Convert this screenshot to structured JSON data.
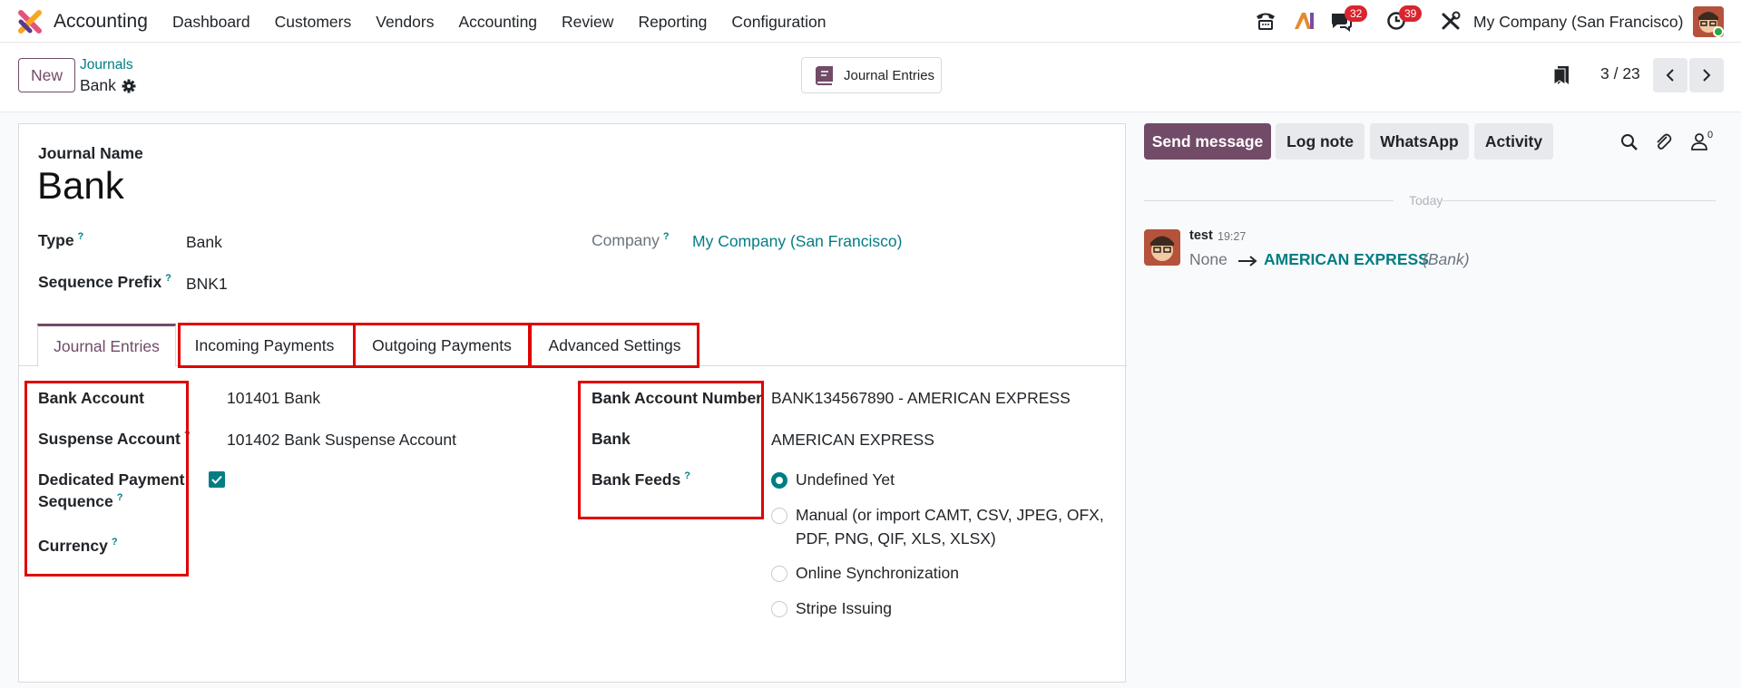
{
  "topbar": {
    "app_name": "Accounting",
    "menu": [
      "Dashboard",
      "Customers",
      "Vendors",
      "Accounting",
      "Review",
      "Reporting",
      "Configuration"
    ],
    "messages_count": "32",
    "activities_count": "39",
    "company": "My Company (San Francisco)"
  },
  "control_panel": {
    "new_label": "New",
    "breadcrumb_parent": "Journals",
    "breadcrumb_current": "Bank",
    "journal_entries_button": "Journal Entries",
    "pager": "3 / 23"
  },
  "form": {
    "journal_name_label": "Journal Name",
    "journal_name": "Bank",
    "type_label": "Type",
    "type_value": "Bank",
    "company_label": "Company",
    "company_value": "My Company (San Francisco)",
    "sequence_prefix_label": "Sequence Prefix",
    "sequence_prefix_value": "BNK1",
    "tabs": [
      "Journal Entries",
      "Incoming Payments",
      "Outgoing Payments",
      "Advanced Settings"
    ],
    "bank_account_label": "Bank Account",
    "bank_account_value": "101401 Bank",
    "suspense_account_label": "Suspense Account",
    "suspense_account_value": "101402 Bank Suspense Account",
    "dedicated_payment_label_1": "Dedicated Payment",
    "dedicated_payment_label_2": "Sequence",
    "dedicated_payment_checked": true,
    "currency_label": "Currency",
    "bank_account_number_label": "Bank Account Number",
    "bank_account_number_value": "BANK134567890 - AMERICAN EXPRESS",
    "bank_label": "Bank",
    "bank_value": "AMERICAN EXPRESS",
    "bank_feeds_label": "Bank Feeds",
    "bank_feeds_options": [
      "Undefined Yet",
      "Manual (or import CAMT, CSV, JPEG, OFX,",
      "PDF, PNG, QIF, XLS, XLSX)",
      "Online Synchronization",
      "Stripe Issuing"
    ],
    "bank_feeds_selected": "Undefined Yet"
  },
  "chatter": {
    "send_message": "Send message",
    "log_note": "Log note",
    "whatsapp": "WhatsApp",
    "activity": "Activity",
    "followers_count": "0",
    "date_separator": "Today",
    "message_author": "test",
    "message_time": "19:27",
    "old_value": "None",
    "new_value": "AMERICAN EXPRESS",
    "field_name": "(Bank)"
  },
  "colors": {
    "brand": "#714b67",
    "link": "#017e84",
    "highlight": "#e00000",
    "badge": "#d9252f"
  }
}
